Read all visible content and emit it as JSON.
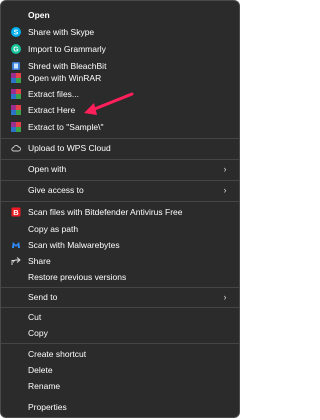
{
  "menu": {
    "open": "Open",
    "share_skype": "Share with Skype",
    "import_grammarly": "Import to Grammarly",
    "shred_bleachbit": "Shred with BleachBit",
    "open_winrar": "Open with WinRAR",
    "extract_files": "Extract files...",
    "extract_here": "Extract Here",
    "extract_to": "Extract to \"Sample\\\"",
    "upload_wps": "Upload to WPS Cloud",
    "open_with": "Open with",
    "give_access": "Give access to",
    "scan_bitdefender": "Scan files with Bitdefender Antivirus Free",
    "copy_path": "Copy as path",
    "scan_malwarebytes": "Scan with Malwarebytes",
    "share": "Share",
    "restore_versions": "Restore previous versions",
    "send_to": "Send to",
    "cut": "Cut",
    "copy": "Copy",
    "create_shortcut": "Create shortcut",
    "delete": "Delete",
    "rename": "Rename",
    "properties": "Properties"
  },
  "colors": {
    "menu_bg": "#2b2b2b",
    "text": "#ffffff",
    "separator": "#454545",
    "annotation_arrow": "#ff1f5a"
  }
}
